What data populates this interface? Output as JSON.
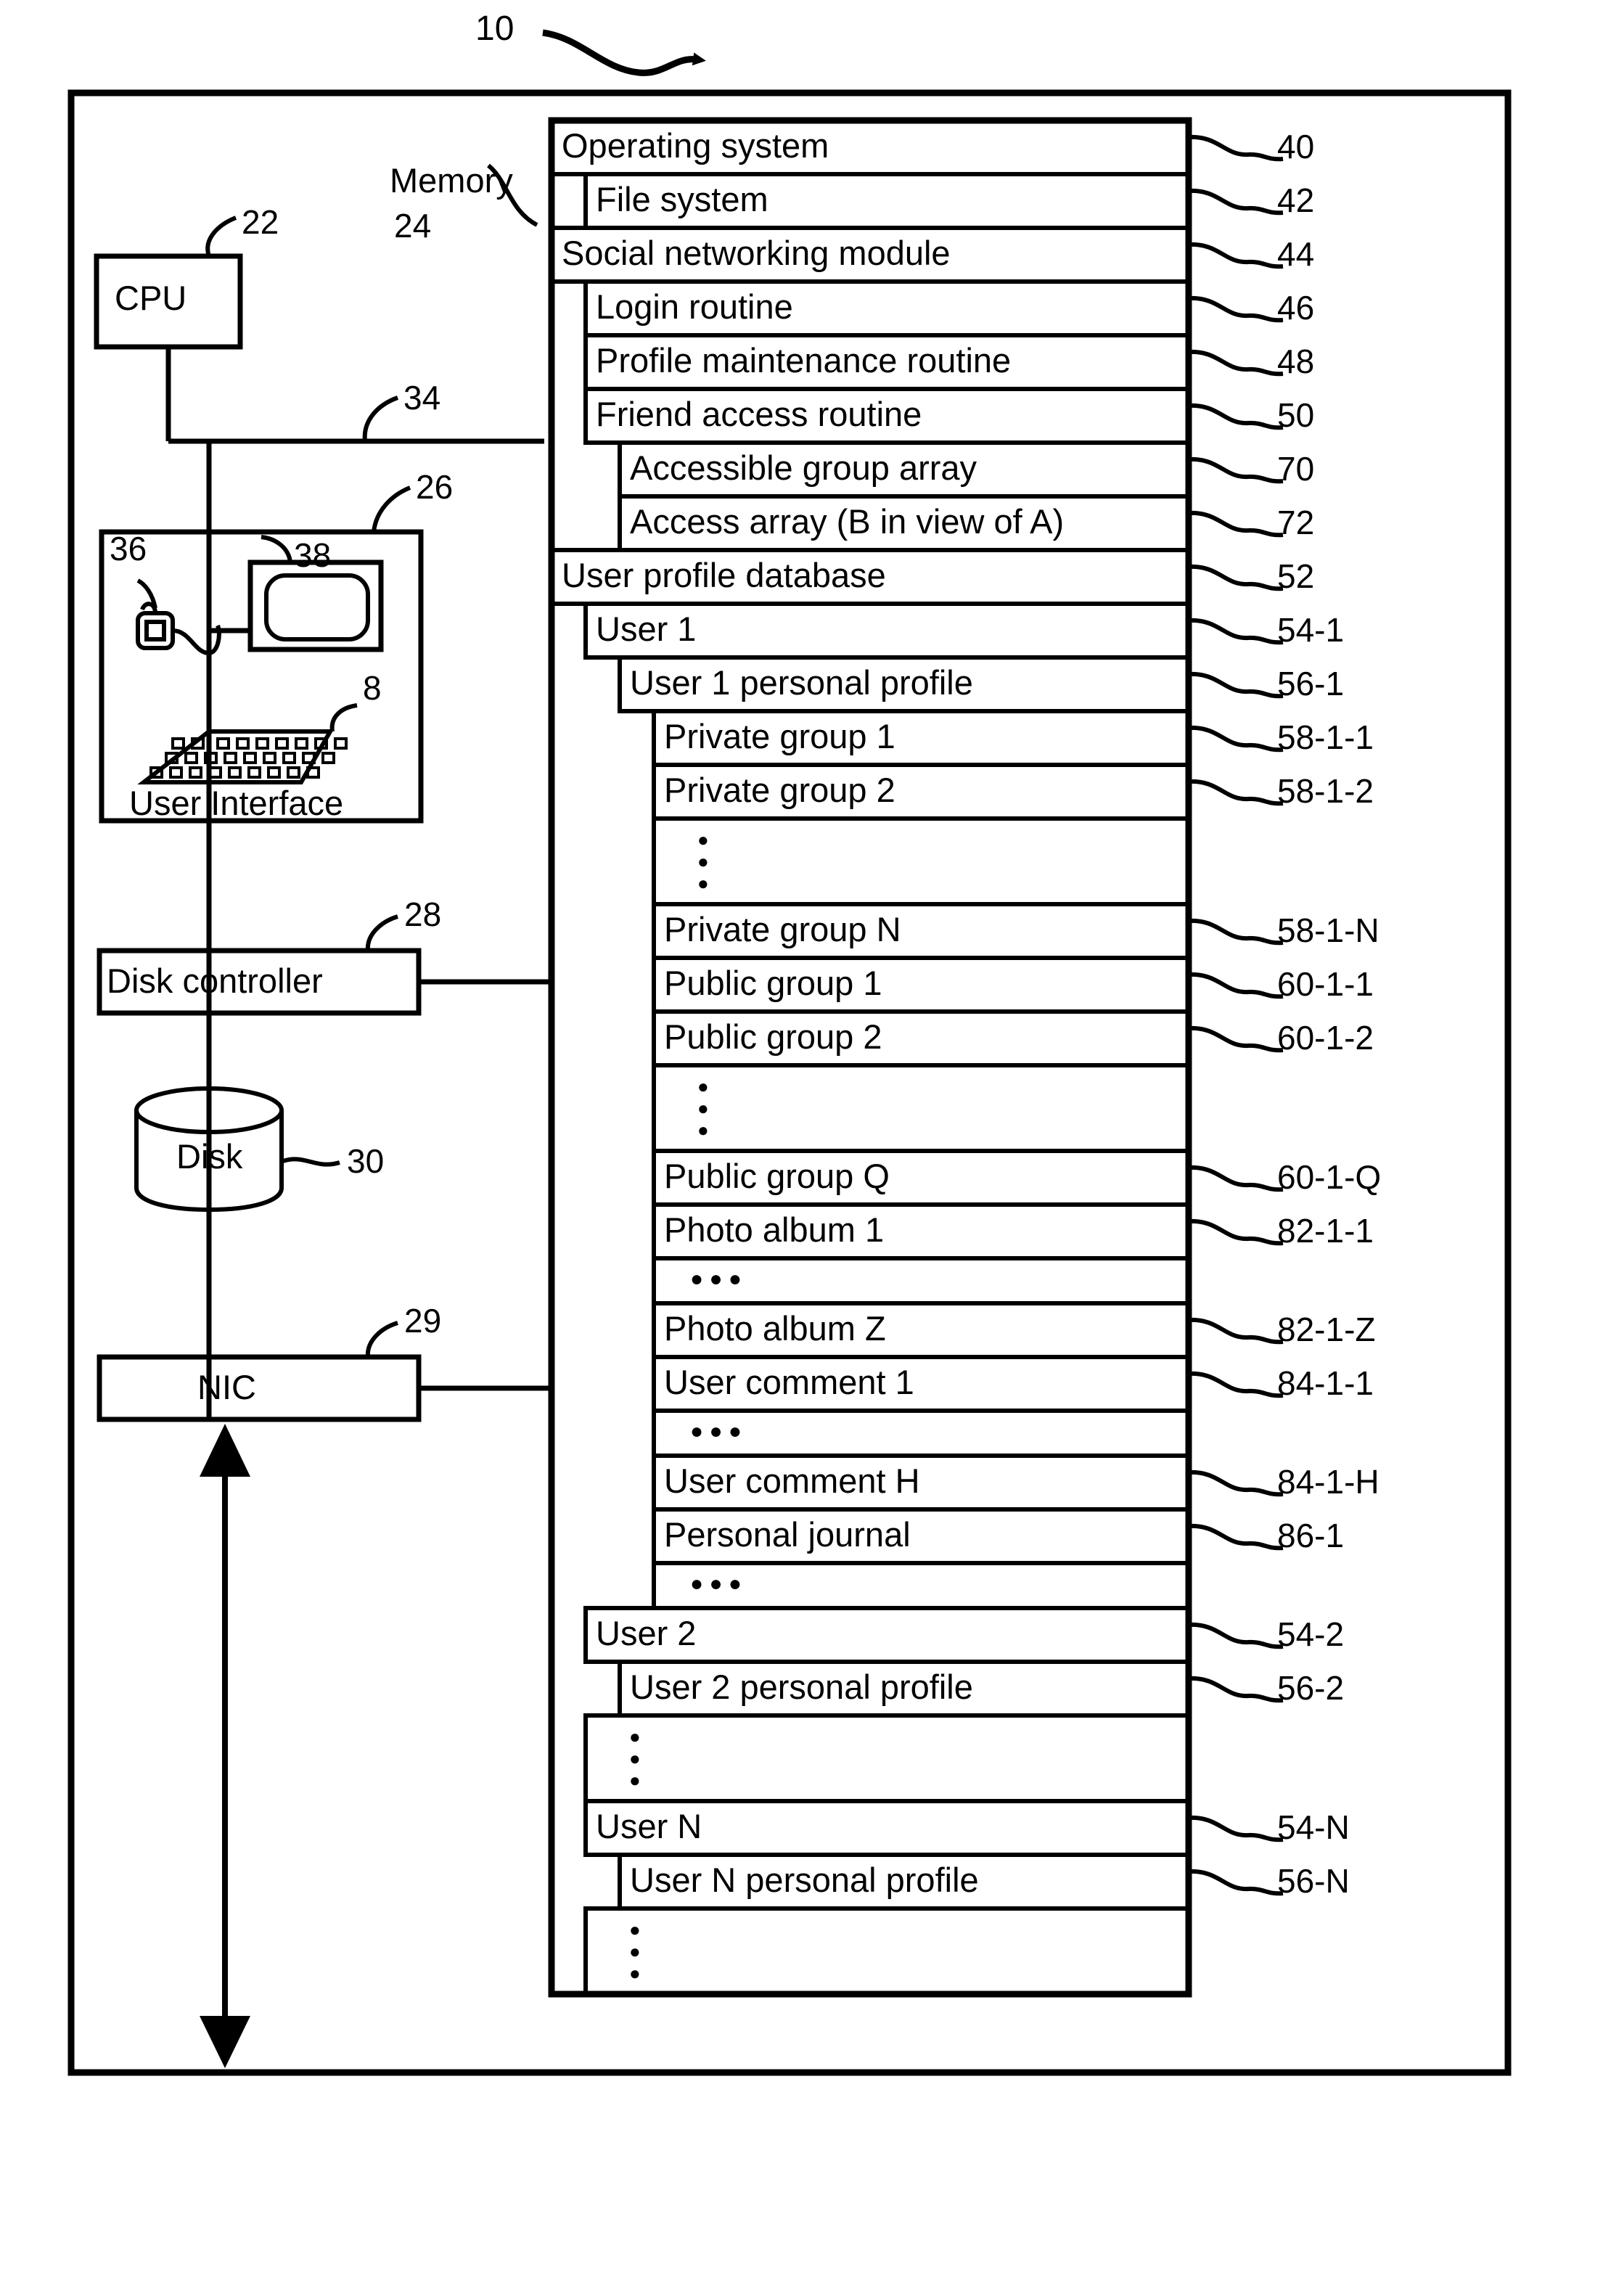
{
  "figure": {
    "figure_ref": "10"
  },
  "hardware": {
    "cpu": {
      "label": "CPU",
      "ref": "22"
    },
    "memory": {
      "label": "Memory",
      "ref": "24"
    },
    "bus": {
      "ref": "34"
    },
    "user_interface": {
      "label": "User Interface",
      "ref": "26"
    },
    "mouse": {
      "ref": "36"
    },
    "monitor": {
      "ref": "38"
    },
    "keyboard": {
      "ref": "8"
    },
    "disk_controller": {
      "label": "Disk controller",
      "ref": "28"
    },
    "disk": {
      "label": "Disk",
      "ref": "30"
    },
    "nic": {
      "label": "NIC",
      "ref": "29"
    }
  },
  "memory_rows": [
    {
      "label": "Operating system",
      "ref": "40",
      "indent": 0
    },
    {
      "label": "File system",
      "ref": "42",
      "indent": 1
    },
    {
      "label": "Social networking module",
      "ref": "44",
      "indent": 0
    },
    {
      "label": "Login routine",
      "ref": "46",
      "indent": 1
    },
    {
      "label": "Profile maintenance routine",
      "ref": "48",
      "indent": 1
    },
    {
      "label": "Friend access routine",
      "ref": "50",
      "indent": 1
    },
    {
      "label": "Accessible group array",
      "ref": "70",
      "indent": 2
    },
    {
      "label": "Access array (B in view of A)",
      "ref": "72",
      "indent": 2
    },
    {
      "label": "User profile database",
      "ref": "52",
      "indent": 0
    },
    {
      "label": "User 1",
      "ref": "54-1",
      "indent": 1
    },
    {
      "label": "User 1 personal profile",
      "ref": "56-1",
      "indent": 2
    },
    {
      "label": "Private group 1",
      "ref": "58-1-1",
      "indent": 3
    },
    {
      "label": "Private group 2",
      "ref": "58-1-2",
      "indent": 3
    },
    {
      "label": "⋮",
      "ref": "",
      "indent": 3,
      "ellipsis": "vertical"
    },
    {
      "label": "Private group N",
      "ref": "58-1-N",
      "indent": 3
    },
    {
      "label": "Public group 1",
      "ref": "60-1-1",
      "indent": 3
    },
    {
      "label": "Public group 2",
      "ref": "60-1-2",
      "indent": 3
    },
    {
      "label": "⋮",
      "ref": "",
      "indent": 3,
      "ellipsis": "vertical"
    },
    {
      "label": "Public group Q",
      "ref": "60-1-Q",
      "indent": 3
    },
    {
      "label": "Photo album 1",
      "ref": "82-1-1",
      "indent": 3
    },
    {
      "label": "• • •",
      "ref": "",
      "indent": 3,
      "ellipsis": "horizontal"
    },
    {
      "label": "Photo album Z",
      "ref": "82-1-Z",
      "indent": 3
    },
    {
      "label": "User comment 1",
      "ref": "84-1-1",
      "indent": 3
    },
    {
      "label": "• • •",
      "ref": "",
      "indent": 3,
      "ellipsis": "horizontal"
    },
    {
      "label": "User comment H",
      "ref": "84-1-H",
      "indent": 3
    },
    {
      "label": "Personal journal",
      "ref": "86-1",
      "indent": 3
    },
    {
      "label": "• • •",
      "ref": "",
      "indent": 3,
      "ellipsis": "horizontal"
    },
    {
      "label": "User 2",
      "ref": "54-2",
      "indent": 1
    },
    {
      "label": "User 2 personal profile",
      "ref": "56-2",
      "indent": 2
    },
    {
      "label": "⋮",
      "ref": "",
      "indent": 1,
      "ellipsis": "vertical"
    },
    {
      "label": "User N",
      "ref": "54-N",
      "indent": 1
    },
    {
      "label": "User N personal profile",
      "ref": "56-N",
      "indent": 2
    },
    {
      "label": "⋮",
      "ref": "",
      "indent": 1,
      "ellipsis": "vertical"
    }
  ]
}
